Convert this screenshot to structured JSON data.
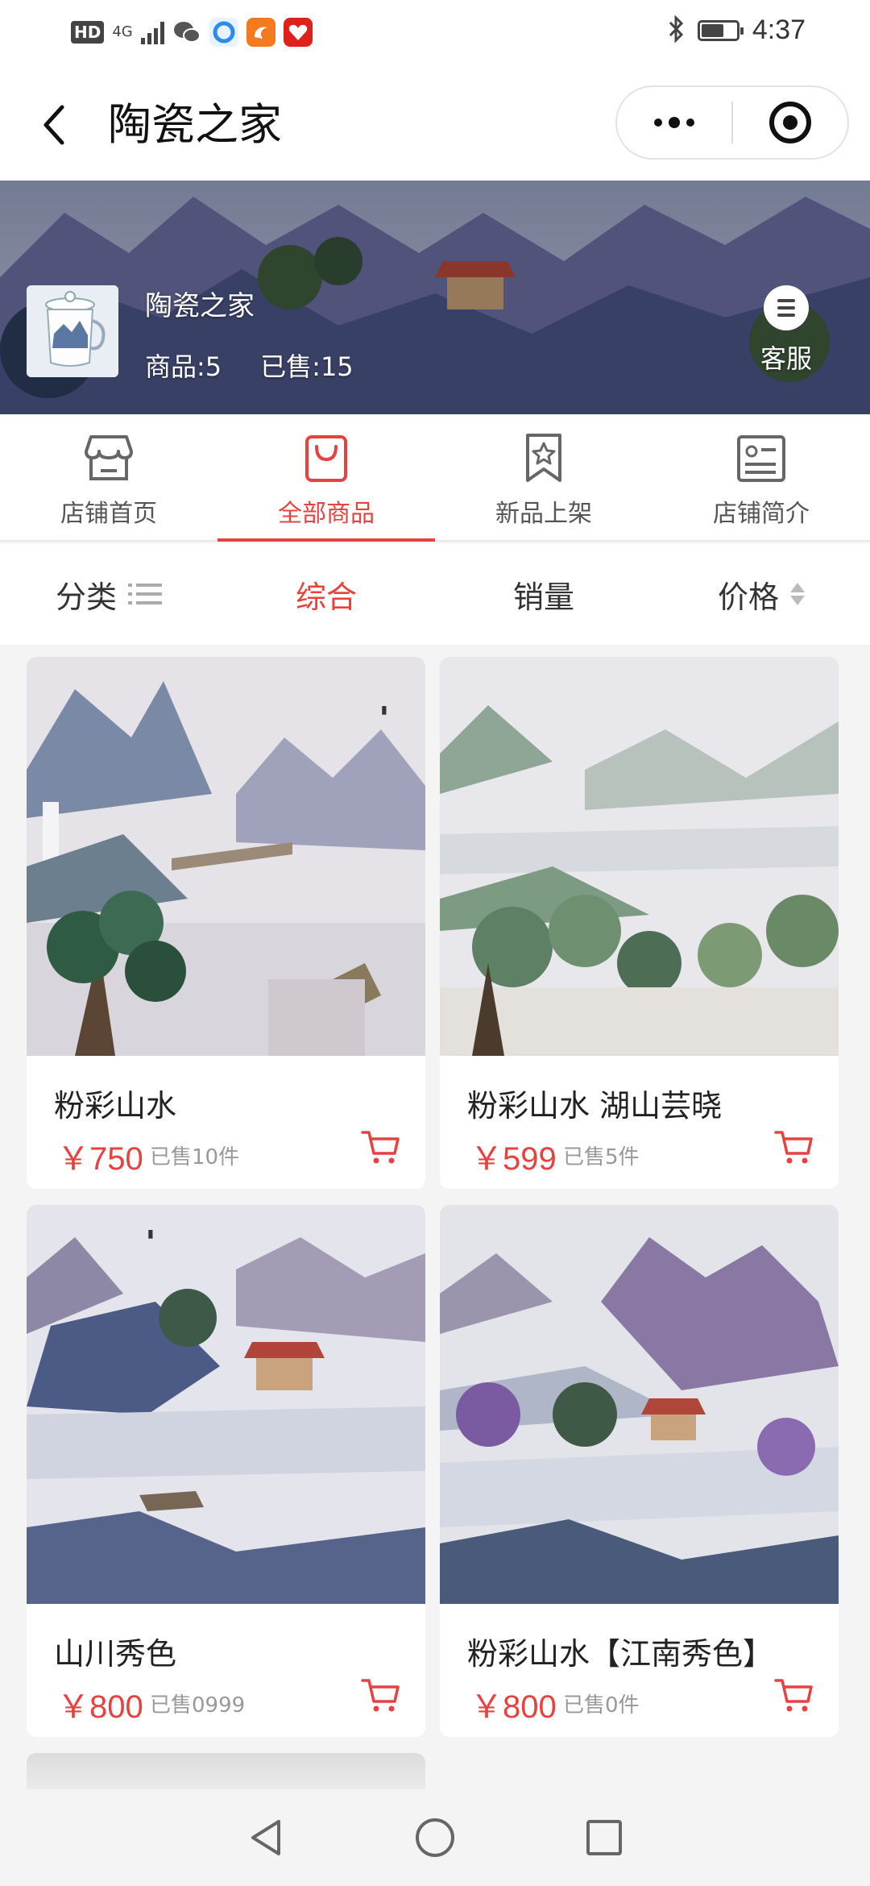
{
  "status_bar": {
    "hd": "HD",
    "network": "4G",
    "time": "4:37",
    "battery_level": 0.6,
    "app_icons": [
      "wechat-icon",
      "qq-browser-icon",
      "uc-icon",
      "pinduoduo-icon"
    ]
  },
  "nav": {
    "title": "陶瓷之家"
  },
  "shop": {
    "name": "陶瓷之家",
    "products_count": "商品:5",
    "sold_count": "已售:15",
    "customer_service_label": "客服"
  },
  "shop_tabs": [
    {
      "label": "店铺首页",
      "icon": "store-icon",
      "active": false
    },
    {
      "label": "全部商品",
      "icon": "shopping-bag-icon",
      "active": true
    },
    {
      "label": "新品上架",
      "icon": "new-bookmark-icon",
      "active": false
    },
    {
      "label": "店铺简介",
      "icon": "profile-card-icon",
      "active": false
    }
  ],
  "sort_bar": {
    "category": "分类",
    "overall": "综合",
    "sales": "销量",
    "price": "价格"
  },
  "products": [
    {
      "name": "粉彩山水",
      "price": "￥750",
      "sold": "已售10件",
      "image": "landscape-painting-waterfall"
    },
    {
      "name": "粉彩山水 湖山芸晓",
      "price": "￥599",
      "sold": "已售5件",
      "image": "landscape-painting-green-lake"
    },
    {
      "name": "山川秀色",
      "price": "￥800",
      "sold": "已售0999",
      "image": "landscape-painting-pavilion"
    },
    {
      "name": "粉彩山水【江南秀色】",
      "price": "￥800",
      "sold": "已售0件",
      "image": "landscape-painting-jiangnan"
    }
  ],
  "colors": {
    "accent": "#e8413e",
    "text": "#222222",
    "muted": "#999999",
    "background": "#f4f4f4"
  }
}
